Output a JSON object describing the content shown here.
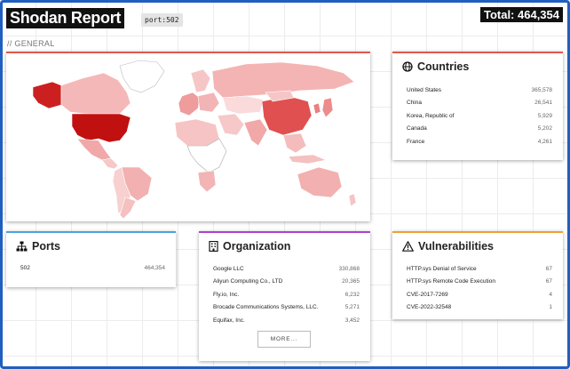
{
  "header": {
    "title": "Shodan Report",
    "query": "port:502",
    "total": "Total: 464,354"
  },
  "section_label": "// GENERAL",
  "colors": {
    "frame": "#1f5fbf",
    "map_accent": "#e05a4a",
    "ports_accent": "#4aa3df",
    "org_accent": "#b03fd0",
    "vuln_accent": "#f0a030"
  },
  "map": {
    "darkest": [
      "United States",
      "China"
    ],
    "icon": "world-map"
  },
  "countries": {
    "title": "Countries",
    "icon": "globe-icon",
    "items": [
      {
        "name": "United States",
        "count": "365,578"
      },
      {
        "name": "China",
        "count": "26,541"
      },
      {
        "name": "Korea, Republic of",
        "count": "5,929"
      },
      {
        "name": "Canada",
        "count": "5,202"
      },
      {
        "name": "France",
        "count": "4,261"
      }
    ]
  },
  "ports": {
    "title": "Ports",
    "icon": "sitemap-icon",
    "items": [
      {
        "name": "502",
        "count": "464,354"
      }
    ]
  },
  "organization": {
    "title": "Organization",
    "icon": "building-icon",
    "items": [
      {
        "name": "Google LLC",
        "count": "330,868"
      },
      {
        "name": "Aliyun Computing Co., LTD",
        "count": "20,365"
      },
      {
        "name": "Fly.io, Inc.",
        "count": "6,232"
      },
      {
        "name": "Brocade Communications Systems, LLC.",
        "count": "5,271"
      },
      {
        "name": "Equifax, Inc.",
        "count": "3,452"
      }
    ],
    "more_label": "MORE..."
  },
  "vulnerabilities": {
    "title": "Vulnerabilities",
    "icon": "warning-icon",
    "items": [
      {
        "name": "HTTP.sys Denial of Service",
        "count": "67"
      },
      {
        "name": "HTTP.sys Remote Code Execution",
        "count": "67"
      },
      {
        "name": "CVE-2017-7269",
        "count": "4"
      },
      {
        "name": "CVE-2022-32548",
        "count": "1"
      }
    ]
  }
}
